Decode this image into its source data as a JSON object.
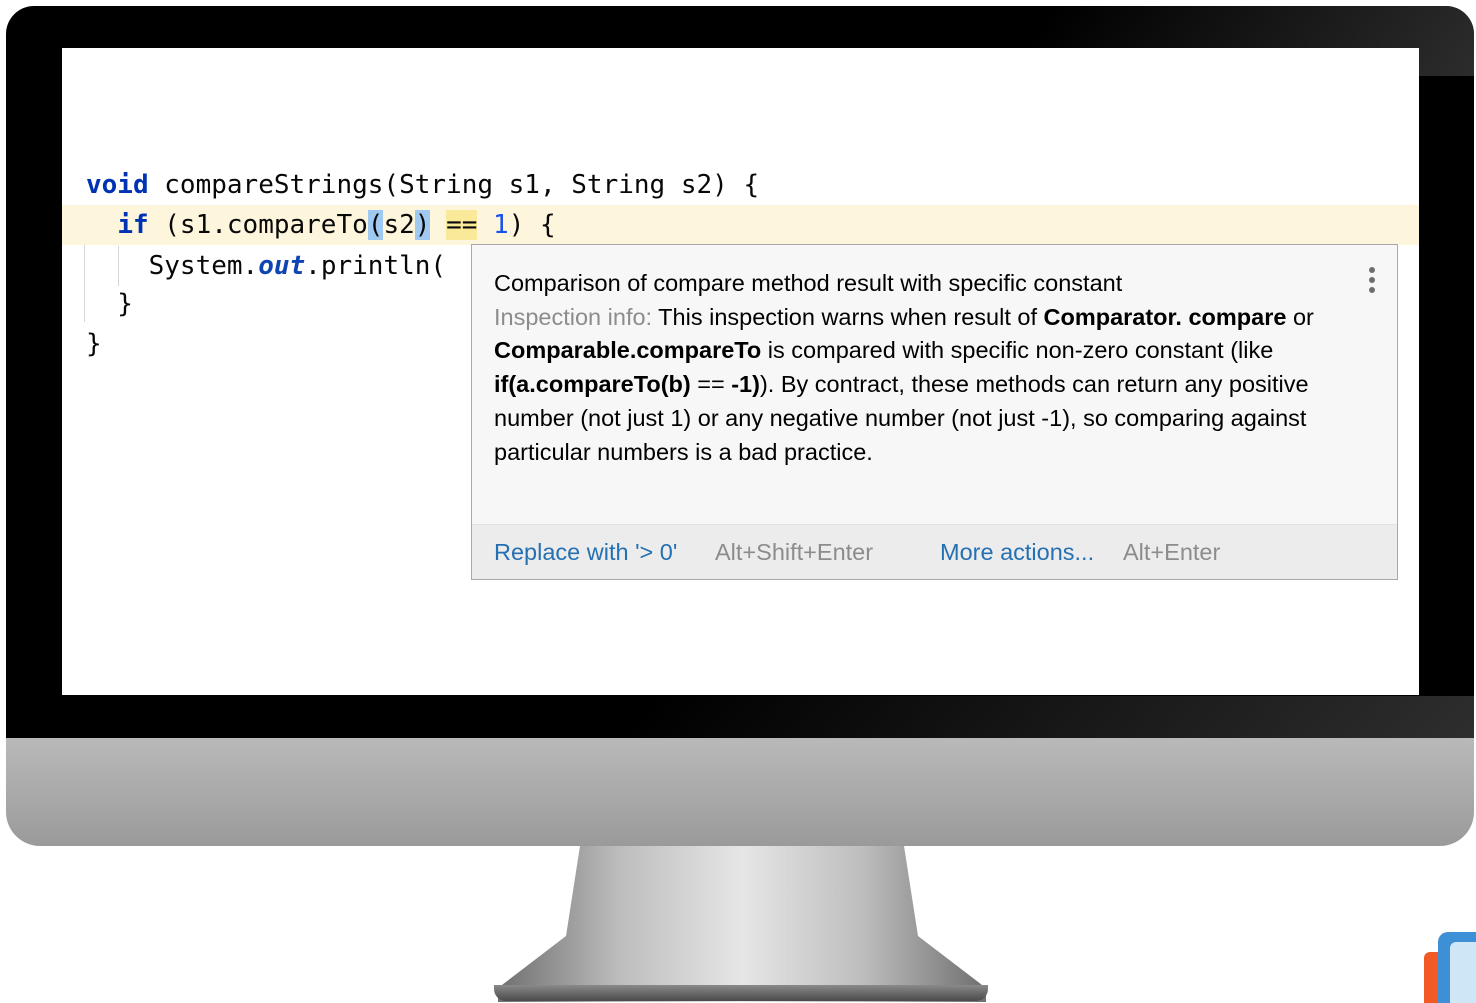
{
  "editor": {
    "lines": {
      "l1": {
        "kw": "void",
        "text": " compareStrings(String s1, String s2) {"
      },
      "l2": {
        "indent": "  ",
        "kw": "if",
        "a": " (s1.compareTo",
        "p1": "(",
        "b": "s2",
        "p2": ")",
        "sp": " ",
        "op": "==",
        "sp2": " ",
        "num": "1",
        "c": ") {"
      },
      "l3": {
        "indent": "    ",
        "a": "System.",
        "field": "out",
        "b": ".println("
      },
      "l4": {
        "text": "  }"
      },
      "l5": {
        "text": "}"
      }
    }
  },
  "popup": {
    "title": "Comparison of compare method result with specific constant",
    "info_label": "Inspection info:",
    "p1": " This inspection warns when result of ",
    "b1": "Comparator.",
    "b2": "compare",
    "p2": " or ",
    "b3": "Comparable.compareTo",
    "p3": " is compared with specific non-zero constant (like ",
    "b4": "if(a.compareTo(b)",
    "p4": " == ",
    "b5": "-1)",
    "p5": "). By contract, these methods can return any positive number (not just 1) or any negative number (not just -1), so comparing against particular numbers is a bad practice.",
    "menu_icon": "more-vertical-icon",
    "footer": {
      "action_label": "Replace with '> 0'",
      "action_shortcut": "Alt+Shift+Enter",
      "more_label": "More actions...",
      "more_shortcut": "Alt+Enter"
    }
  },
  "colors": {
    "keyword": "#0033b3",
    "number": "#1750eb",
    "link": "#2470b3",
    "line_highlight": "#fdf6dd"
  }
}
